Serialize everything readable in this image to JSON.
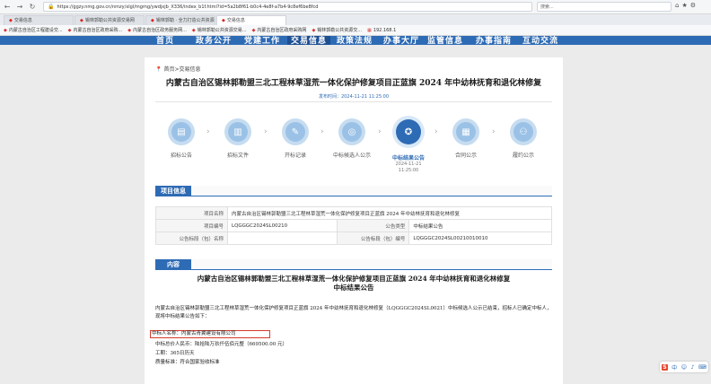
{
  "browser": {
    "url": "https://ggzy.nmg.gov.cn/nmzy/xlgl/mgmg/ywdjxjb_X336/index_b1f.html?id=5a2b8f61-b0c4-4e8f-a7b4-9c8ef6be8fcd",
    "search_placeholder": "搜索...",
    "tabs": [
      "交易信息",
      "锡林郭勒公共资源交易网",
      "锡林郭勒 · 全力打造公共资源",
      "交易信息"
    ],
    "bookmarks": [
      "内蒙古自治区工程建设交...",
      "内蒙古自治区政府采购...",
      "内蒙古自治区政务服务网...",
      "锡林郭勒公共资源交易...",
      "内蒙古自治区政府采购网",
      "锡林郭勒公共资源交...",
      "192.168.1"
    ]
  },
  "site_nav": {
    "items": [
      "首页",
      "政务公开",
      "党建工作",
      "交易信息",
      "政策法规",
      "办事大厅",
      "监管信息",
      "办事指南",
      "互动交流"
    ],
    "active_index": 3
  },
  "breadcrumb": "首页>交易信息",
  "title": "内蒙古自治区锡林郭勒盟三北工程林草湿荒一体化保护修复项目正蓝旗 2024 年中幼林抚育和退化林修复",
  "publish_time": "发布时间：2024-11-21 11:25:00",
  "steps": [
    {
      "label": "招标公告",
      "icon": "clipboard-icon"
    },
    {
      "label": "招标文件",
      "icon": "document-icon"
    },
    {
      "label": "开标记录",
      "icon": "pen-icon"
    },
    {
      "label": "中标候选人公示",
      "icon": "target-icon"
    },
    {
      "label": "中标结果公告",
      "icon": "award-icon",
      "date": "2024-11-21",
      "time": "11:25:00"
    },
    {
      "label": "合同公示",
      "icon": "contract-icon"
    },
    {
      "label": "履约公示",
      "icon": "people-icon"
    }
  ],
  "active_step": 4,
  "section_info": "项目信息",
  "info": {
    "project_name_label": "项目名称",
    "project_name": "内蒙古自治区锡林郭勒盟三北工程林草湿荒一体化保护修复项目正蓝旗 2024 年中幼林抚育和退化林修复",
    "project_code_label": "项目编号",
    "project_code": "LQGGGC2024SL00210",
    "notice_type_label": "公告类型",
    "notice_type": "中标结果公告",
    "section_name_label": "公告标段（包）名称",
    "section_name": "",
    "section_code_label": "公告标段（包）编号",
    "section_code": "LQGGGC2024SL00210010010"
  },
  "section_content": "内容",
  "doc_title_1": "内蒙古自治区锡林郭勒盟三北工程林草湿荒一体化保护修复项目正蓝旗 2024 年中幼林抚育和退化林修复",
  "doc_title_2": "中标结果公告",
  "paragraph": "内蒙古自治区锡林郭勒盟三北工程林草湿荒一体化保护修复项目正蓝旗 2024 年中幼林抚育和退化林修复（LQGGGC2024SL0021）中标候选人公示已结束，招标人已确定中标人，现将中标结果公告如下：",
  "winner": "中标人名称：内蒙古青翼建设有限公司",
  "amount": "中标总价人民币：陆拾陆万玖仟伍佰元整（669500.00 元）",
  "duration": "工期：365日历天",
  "quality": "质量标准：符合国家验收标准",
  "colors": {
    "brand_blue": "#2e6bb5",
    "highlight_red": "#d53b2b"
  }
}
